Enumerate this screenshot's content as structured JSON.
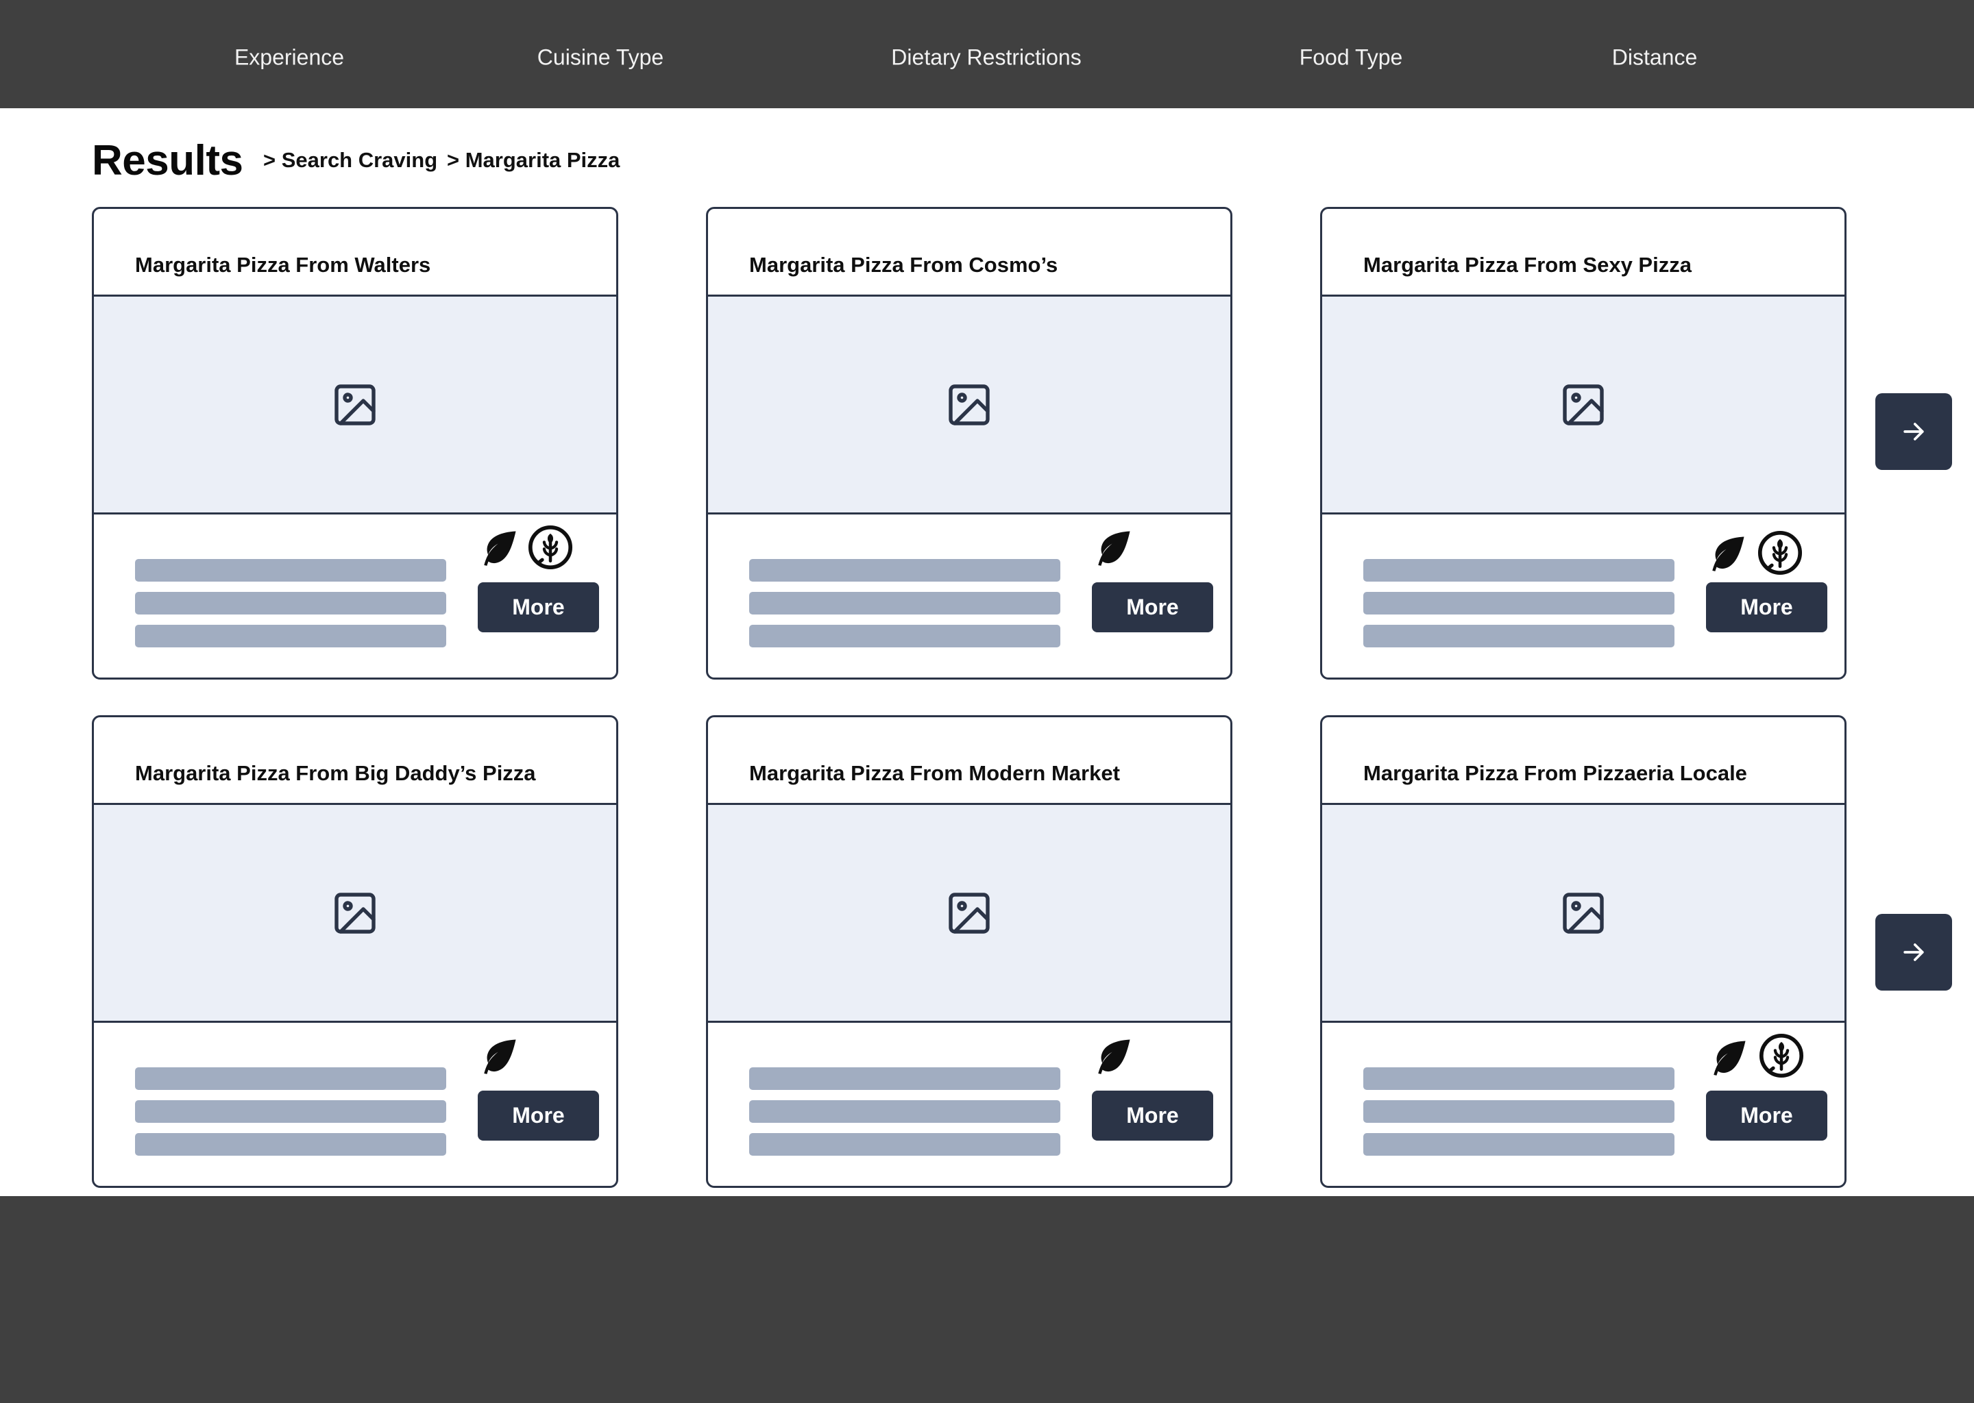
{
  "nav": {
    "items": [
      {
        "label": "Experience"
      },
      {
        "label": "Cuisine Type"
      },
      {
        "label": "Dietary Restrictions"
      },
      {
        "label": "Food Type"
      },
      {
        "label": "Distance"
      }
    ]
  },
  "page": {
    "title": "Results",
    "breadcrumb": [
      "> Search Craving",
      "> Margarita Pizza"
    ]
  },
  "cards": [
    {
      "title": "Margarita Pizza From Walters",
      "badges": [
        "leaf-icon",
        "grain-icon"
      ],
      "button_label": "More"
    },
    {
      "title": "Margarita Pizza From Cosmo’s",
      "badges": [
        "leaf-icon"
      ],
      "button_label": "More"
    },
    {
      "title": "Margarita Pizza From Sexy Pizza",
      "badges": [
        "leaf-icon",
        "grain-icon"
      ],
      "button_label": "More"
    },
    {
      "title": "Margarita Pizza From Big Daddy’s Pizza",
      "badges": [
        "leaf-icon"
      ],
      "button_label": "More"
    },
    {
      "title": "Margarita Pizza From Modern Market",
      "badges": [
        "leaf-icon"
      ],
      "button_label": "More"
    },
    {
      "title": "Margarita Pizza From Pizzaeria Locale",
      "badges": [
        "leaf-icon",
        "grain-icon"
      ],
      "button_label": "More"
    }
  ],
  "colors": {
    "nav_background": "#404040",
    "accent_dark": "#2b3447",
    "image_placeholder": "#ebeff7",
    "skeleton": "#a1adc1"
  },
  "icons": {
    "next_button": "arrow-right-icon",
    "image_placeholder": "image-icon"
  }
}
